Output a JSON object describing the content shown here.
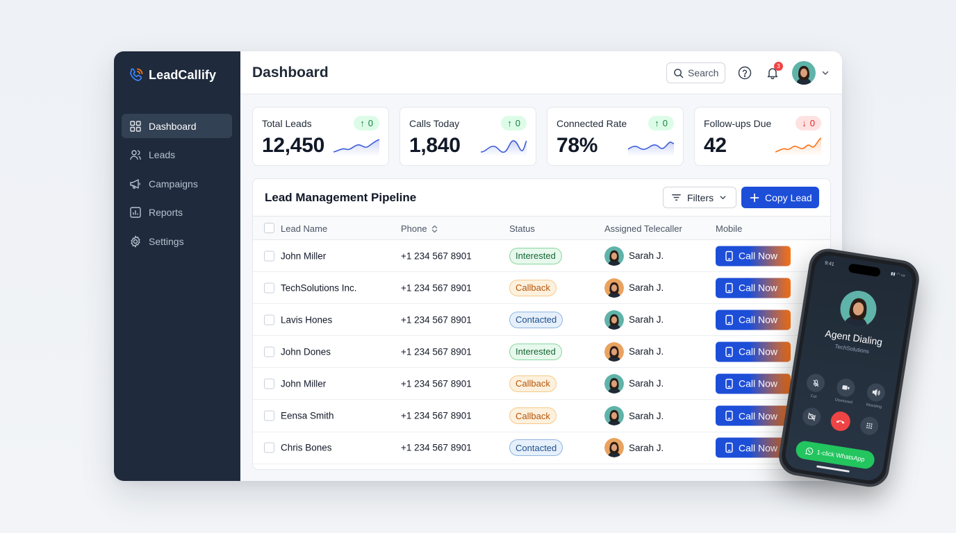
{
  "brand": {
    "name": "LeadCallify",
    "accent": "#1d4ed8",
    "accent2": "#f97316"
  },
  "sidebar": {
    "items": [
      {
        "label": "Dashboard",
        "icon": "dashboard-icon",
        "active": true
      },
      {
        "label": "Leads",
        "icon": "users-icon",
        "active": false
      },
      {
        "label": "Campaigns",
        "icon": "megaphone-icon",
        "active": false
      },
      {
        "label": "Reports",
        "icon": "chart-icon",
        "active": false
      },
      {
        "label": "Settings",
        "icon": "gear-icon",
        "active": false
      }
    ]
  },
  "header": {
    "title": "Dashboard",
    "search_label": "Search",
    "notification_count": "3"
  },
  "stats": [
    {
      "label": "Total Leads",
      "value": "12,450",
      "delta": "0",
      "trend": "up",
      "color": "#3b5bdb"
    },
    {
      "label": "Calls Today",
      "value": "1,840",
      "delta": "0",
      "trend": "up",
      "color": "#3b5bdb"
    },
    {
      "label": "Connected Rate",
      "value": "78%",
      "delta": "0",
      "trend": "up",
      "color": "#3b5bdb"
    },
    {
      "label": "Follow-ups Due",
      "value": "42",
      "delta": "0",
      "trend": "down",
      "color": "#f97316"
    }
  ],
  "pipeline": {
    "title": "Lead Management Pipeline",
    "filters_label": "Filters",
    "copy_label": "Copy Lead",
    "columns": [
      "Lead Name",
      "Phone",
      "Status",
      "Assigned Telecaller",
      "Mobile"
    ],
    "rows": [
      {
        "name": "John Miller",
        "phone": "+1 234 567 8901",
        "status": "Interested",
        "status_kind": "green",
        "telecaller": "Sarah J.",
        "action": "Call Now"
      },
      {
        "name": "TechSolutions Inc.",
        "phone": "+1 234 567 8901",
        "status": "Callback",
        "status_kind": "orange",
        "telecaller": "Sarah J.",
        "action": "Call Now"
      },
      {
        "name": "Lavis Hones",
        "phone": "+1 234 567 8901",
        "status": "Contacted",
        "status_kind": "blue",
        "telecaller": "Sarah J.",
        "action": "Call Now"
      },
      {
        "name": "John Dones",
        "phone": "+1 234 567 8901",
        "status": "Interested",
        "status_kind": "green",
        "telecaller": "Sarah J.",
        "action": "Call Now"
      },
      {
        "name": "John Miller",
        "phone": "+1 234 567 8901",
        "status": "Callback",
        "status_kind": "orange",
        "telecaller": "Sarah J.",
        "action": "Call Now"
      },
      {
        "name": "Eensa Smith",
        "phone": "+1 234 567 8901",
        "status": "Callback",
        "status_kind": "orange",
        "telecaller": "Sarah J.",
        "action": "Call Now"
      },
      {
        "name": "Chris Bones",
        "phone": "+1 234 567 8901",
        "status": "Contacted",
        "status_kind": "blue",
        "telecaller": "Sarah J.",
        "action": "Call Now"
      }
    ]
  },
  "phone": {
    "time": "9:41",
    "caller_title": "Agent Dialing",
    "caller_sub": "TechSolutions",
    "controls": [
      {
        "label": "Cut",
        "icon": "mic-off-icon"
      },
      {
        "label": "Dismissed",
        "icon": "video-icon"
      },
      {
        "label": "Resisting",
        "icon": "speaker-icon"
      }
    ],
    "whatsapp_label": "1-click WhatsApp"
  }
}
